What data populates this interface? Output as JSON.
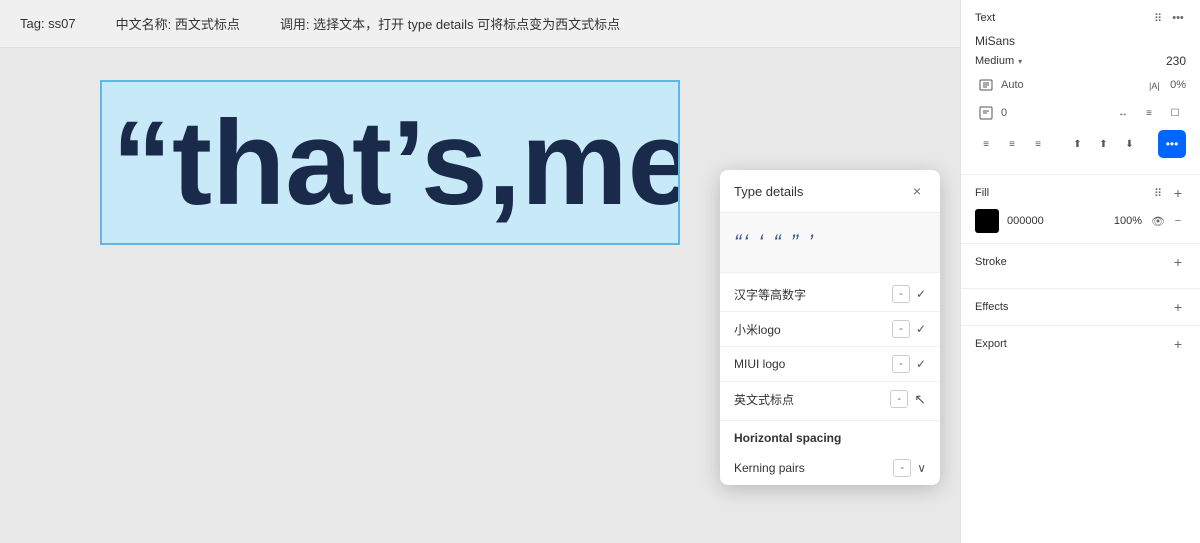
{
  "topbar": {
    "tag_label": "Tag: ss07",
    "name_label": "中文名称: 西文式标点",
    "usage_label": "调用: 选择文本，打开 type details 可将标点变为西文式标点"
  },
  "preview": {
    "text": "“that’s,me"
  },
  "popup": {
    "title": "Type details",
    "close_label": "×",
    "punctuation_preview": "“‘ ‘ “ ” ’",
    "items": [
      {
        "label": "汉字等高数字",
        "minus": "-",
        "checked": true
      },
      {
        "label": "小米logo",
        "minus": "-",
        "checked": true
      },
      {
        "label": "MIUI logo",
        "minus": "-",
        "checked": true
      },
      {
        "label": "英文式标点",
        "minus": "-",
        "checked": true
      }
    ],
    "horizontal_spacing_label": "Horizontal spacing",
    "kerning_label": "Kerning pairs",
    "kerning_minus": "-"
  },
  "right_panel": {
    "text_section": {
      "title": "Text",
      "font_name": "MiSans",
      "font_weight": "Medium",
      "font_size": "230",
      "auto_label": "Auto",
      "kern_pct": "0%",
      "line_height": "0",
      "icons": {
        "grid": "⠿",
        "plus": "+"
      }
    },
    "fill_section": {
      "title": "Fill",
      "color_hex": "000000",
      "opacity": "100%"
    },
    "stroke_section": {
      "title": "Stroke"
    },
    "effects_section": {
      "title": "Effects"
    },
    "export_section": {
      "title": "Export"
    }
  }
}
